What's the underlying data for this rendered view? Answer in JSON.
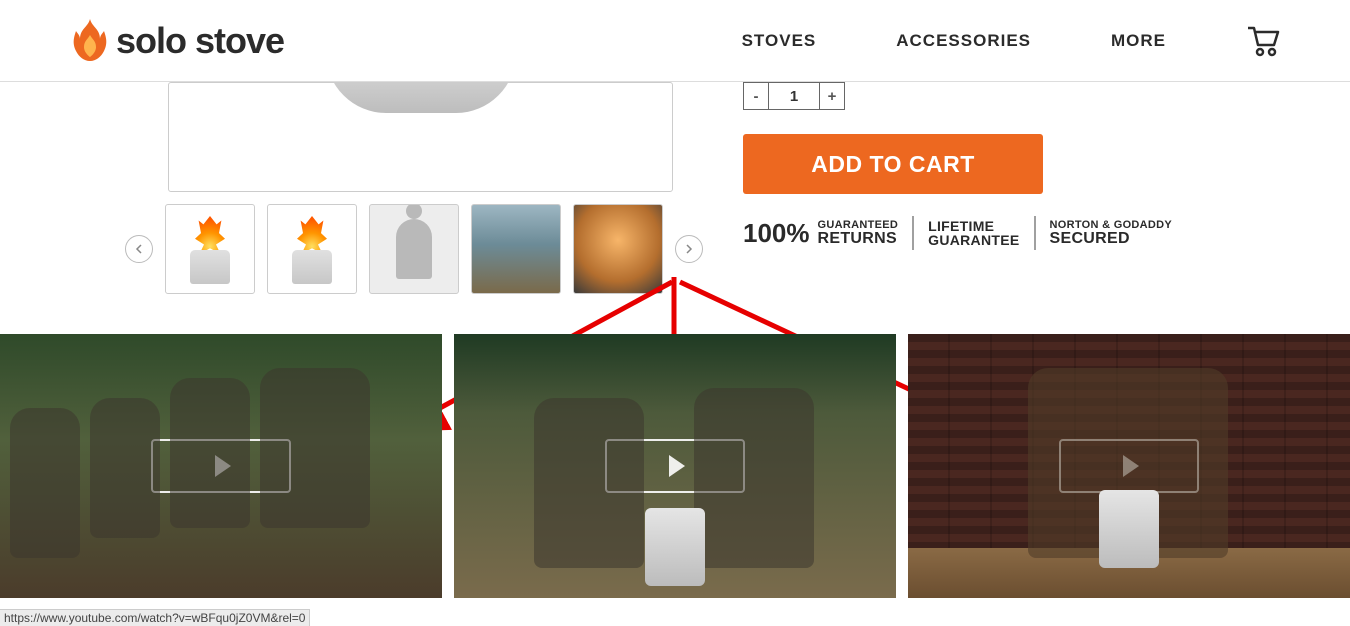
{
  "header": {
    "brand_name": "solo stove",
    "nav": {
      "stoves": "STOVES",
      "accessories": "ACCESSORIES",
      "more": "MORE"
    }
  },
  "product": {
    "quantity": "1",
    "qty_minus": "-",
    "qty_plus": "+",
    "add_to_cart": "ADD TO CART",
    "badges": {
      "hundred": "100%",
      "guaranteed": "GUARANTEED",
      "returns": "RETURNS",
      "lifetime": "LIFETIME",
      "guarantee": "GUARANTEE",
      "norton": "NORTON & GODADDY",
      "secured": "SECURED"
    }
  },
  "status_url": "https://www.youtube.com/watch?v=wBFqu0jZ0VM&rel=0",
  "icons": {
    "flame_color": "#ed6820",
    "arrow_red": "#e60000"
  }
}
